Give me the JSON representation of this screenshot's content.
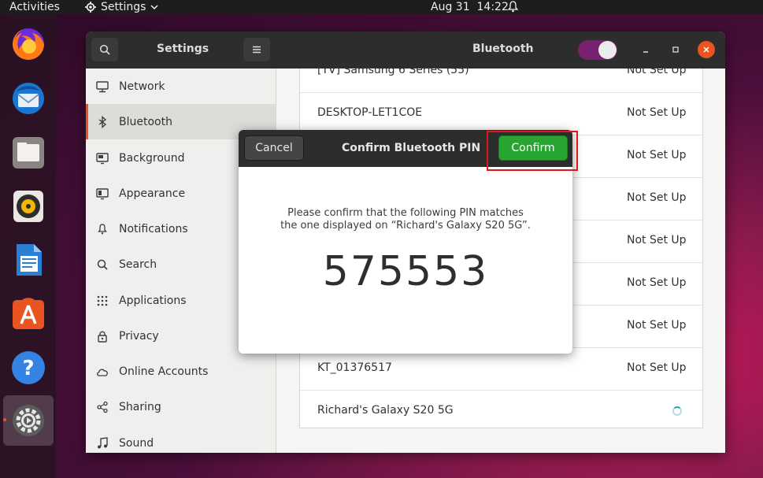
{
  "topbar": {
    "activities": "Activities",
    "app_menu": "Settings",
    "date": "Aug 31",
    "time": "14:22"
  },
  "dock": {
    "items": [
      "firefox-icon",
      "thunderbird-icon",
      "files-icon",
      "rhythmbox-icon",
      "libreoffice-writer-icon",
      "software-center-icon",
      "help-icon",
      "settings-icon"
    ]
  },
  "window": {
    "settings_title": "Settings",
    "panel_title": "Bluetooth",
    "bluetooth_enabled": true
  },
  "sidebar": {
    "items": [
      {
        "label": "Network",
        "icon": "network-icon"
      },
      {
        "label": "Bluetooth",
        "icon": "bluetooth-icon",
        "selected": true
      },
      {
        "label": "Background",
        "icon": "background-icon"
      },
      {
        "label": "Appearance",
        "icon": "appearance-icon"
      },
      {
        "label": "Notifications",
        "icon": "bell-icon"
      },
      {
        "label": "Search",
        "icon": "search-icon"
      },
      {
        "label": "Applications",
        "icon": "grid-icon"
      },
      {
        "label": "Privacy",
        "icon": "lock-icon"
      },
      {
        "label": "Online Accounts",
        "icon": "cloud-icon"
      },
      {
        "label": "Sharing",
        "icon": "share-icon"
      },
      {
        "label": "Sound",
        "icon": "music-icon"
      }
    ]
  },
  "devices": [
    {
      "name": "[TV] Samsung 6 Series (55)",
      "status": "Not Set Up"
    },
    {
      "name": "DESKTOP-LET1COE",
      "status": "Not Set Up"
    },
    {
      "name": "",
      "status": "Not Set Up"
    },
    {
      "name": "",
      "status": "Not Set Up"
    },
    {
      "name": "",
      "status": "Not Set Up"
    },
    {
      "name": "",
      "status": "Not Set Up"
    },
    {
      "name": "",
      "status": "Not Set Up"
    },
    {
      "name": "KT_01376517",
      "status": "Not Set Up"
    },
    {
      "name": "Richard's Galaxy S20 5G",
      "status": ""
    }
  ],
  "dialog": {
    "cancel_label": "Cancel",
    "title": "Confirm Bluetooth PIN",
    "confirm_label": "Confirm",
    "message_line1": "Please confirm that the following PIN matches",
    "message_line2": "the one displayed on “Richard's Galaxy S20 5G”.",
    "pin": "575553"
  },
  "colors": {
    "accent": "#e95420",
    "confirm": "#26a630",
    "toggle": "#77216f",
    "highlight": "#e0161d"
  }
}
